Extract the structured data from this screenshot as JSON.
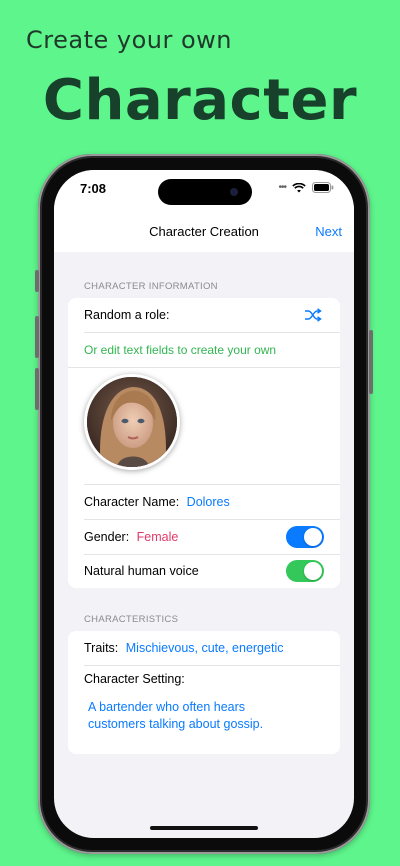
{
  "promo": {
    "subtitle": "Create your own",
    "title": "Character"
  },
  "status": {
    "time": "7:08"
  },
  "nav": {
    "title": "Character Creation",
    "next_label": "Next"
  },
  "section_info": {
    "header": "CHARACTER INFORMATION",
    "random_label": "Random a role:",
    "edit_hint": "Or edit text fields to create your own",
    "name_label": "Character Name:",
    "name_value": "Dolores",
    "gender_label": "Gender:",
    "gender_value": "Female",
    "gender_toggle_on": true,
    "voice_label": "Natural human voice",
    "voice_toggle_on": true
  },
  "section_chars": {
    "header": "CHARACTERISTICS",
    "traits_label": "Traits:",
    "traits_value": "Mischievous, cute, energetic",
    "setting_label": "Character Setting:",
    "setting_value_line1": "A bartender who often hears",
    "setting_value_line2": "customers talking about gossip."
  },
  "icons": {
    "shuffle": "shuffle-icon",
    "wifi": "wifi-icon",
    "battery": "battery-icon"
  },
  "colors": {
    "background": "#5ef58c",
    "accent": "#0a7aff",
    "toggle_blue": "#0a7aff",
    "toggle_green": "#34c759",
    "hint_green": "#32b552",
    "gender_pink": "#e03a6a"
  }
}
